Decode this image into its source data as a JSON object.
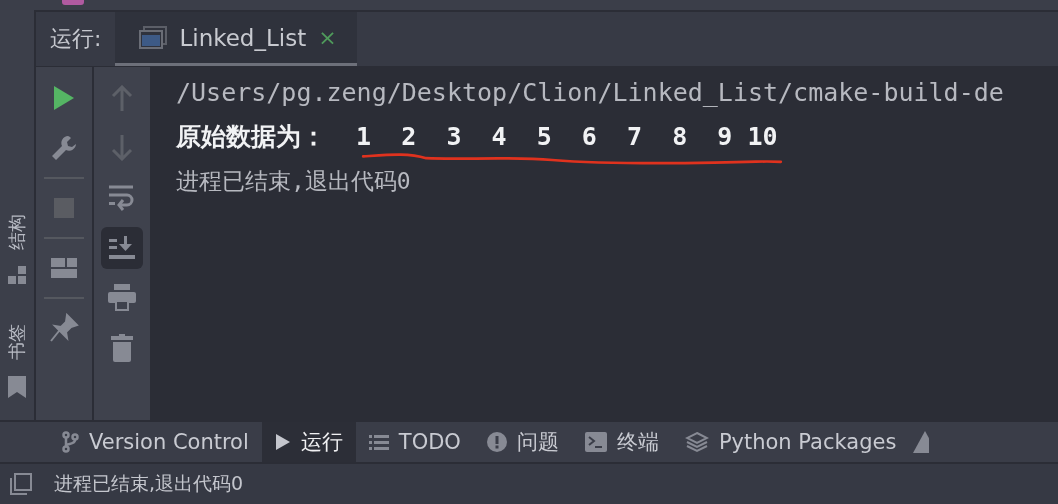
{
  "run_header": {
    "label": "运行:",
    "tabs": [
      {
        "label": "Linked_List",
        "close": "×",
        "selected": true
      }
    ]
  },
  "side_labels": [
    "结构",
    "书签"
  ],
  "console": {
    "lines": [
      {
        "kind": "path",
        "text": "/Users/pg.zeng/Desktop/Clion/Linked_List/cmake-build-de"
      },
      {
        "kind": "output",
        "text": "原始数据为：  1  2  3  4  5  6  7  8  9 10"
      },
      {
        "kind": "info",
        "text": "进程已结束,退出代码0"
      }
    ]
  },
  "tool_tabs": [
    {
      "kind": "vcs",
      "label": "Version Control",
      "selected": false
    },
    {
      "kind": "run",
      "label": "运行",
      "selected": true
    },
    {
      "kind": "todo",
      "label": "TODO",
      "selected": false
    },
    {
      "kind": "problems",
      "label": "问题",
      "selected": false
    },
    {
      "kind": "terminal",
      "label": "终端",
      "selected": false
    },
    {
      "kind": "packages",
      "label": "Python Packages",
      "selected": false
    }
  ],
  "status_bar": {
    "text": "进程已结束,退出代码0"
  }
}
